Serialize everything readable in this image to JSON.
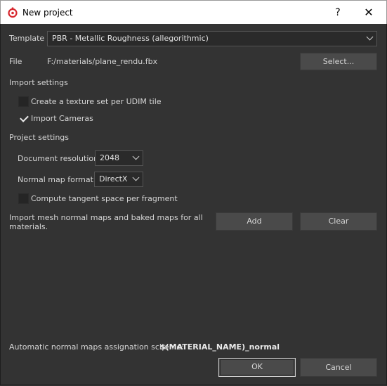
{
  "window": {
    "title": "New project",
    "help_label": "?",
    "close_label": "✕"
  },
  "template": {
    "label": "Template",
    "value": "PBR - Metallic Roughness (allegorithmic)"
  },
  "file": {
    "label": "File",
    "path": "F:/materials/plane_rendu.fbx",
    "select_label": "Select..."
  },
  "import_settings": {
    "heading": "Import settings",
    "udim_label": "Create a texture set per UDIM tile",
    "udim_checked": false,
    "cameras_label": "Import Cameras",
    "cameras_checked": true
  },
  "project_settings": {
    "heading": "Project settings",
    "resolution_label": "Document resolution",
    "resolution_value": "2048",
    "normal_format_label": "Normal map format",
    "normal_format_value": "DirectX",
    "tangent_label": "Compute tangent space per fragment",
    "tangent_checked": false
  },
  "import_maps": {
    "text_line1": "Import mesh normal maps and baked maps for all",
    "text_line2": "materials.",
    "add_label": "Add",
    "clear_label": "Clear"
  },
  "footer": {
    "scheme_label": "Automatic normal maps assignation scheme:",
    "scheme_value": "$(MATERIAL_NAME)_normal",
    "ok_label": "OK",
    "cancel_label": "Cancel"
  },
  "colors": {
    "background": "#333333",
    "button": "#4a4a4a",
    "field": "#2a2a2a",
    "text": "#d6d6d6",
    "app_icon_red": "#d7282f"
  }
}
